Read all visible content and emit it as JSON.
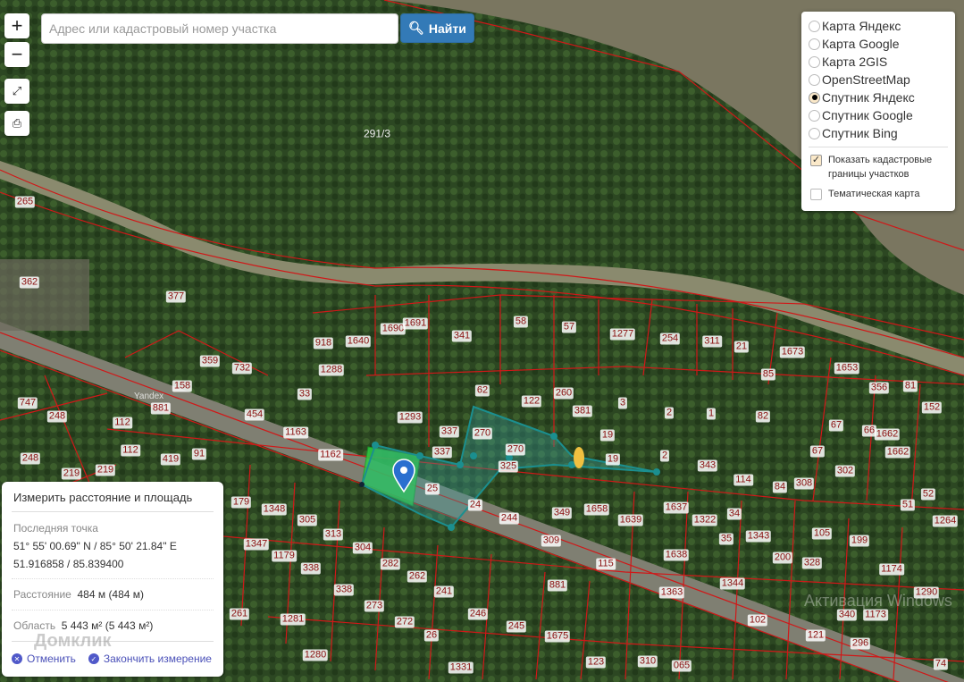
{
  "search": {
    "placeholder": "Адрес или кадастровый номер участка",
    "button": "Найти"
  },
  "controls": {
    "zoom_in": "+",
    "zoom_out": "−"
  },
  "layers": {
    "options": [
      {
        "label": "Карта Яндекс",
        "selected": false
      },
      {
        "label": "Карта Google",
        "selected": false
      },
      {
        "label": "Карта 2GIS",
        "selected": false
      },
      {
        "label": "OpenStreetMap",
        "selected": false
      },
      {
        "label": "Спутник Яндекс",
        "selected": true
      },
      {
        "label": "Спутник Google",
        "selected": false
      },
      {
        "label": "Спутник Bing",
        "selected": false
      }
    ],
    "show_cadastral": "Показать кадастровые границы участков",
    "show_cadastral_checked": true,
    "thematic": "Тематическая карта",
    "thematic_checked": false
  },
  "measure": {
    "title": "Измерить расстояние и площадь",
    "last_point_label": "Последняя точка",
    "dms": "51° 55' 00.69\" N / 85° 50' 21.84\" E",
    "decimal": "51.916858 / 85.839400",
    "distance_label": "Расстояние",
    "distance": "484 м (484 м)",
    "area_label": "Область",
    "area": "5 443 м² (5 443 м²)",
    "cancel": "Отменить",
    "finish": "Закончить измерение"
  },
  "map": {
    "parcels": [
      "291/3",
      "265",
      "362",
      "377",
      "359",
      "732",
      "918",
      "1640",
      "1690",
      "1691",
      "341",
      "58",
      "57",
      "1277",
      "254",
      "311",
      "21",
      "1673",
      "1653",
      "356",
      "81",
      "152",
      "1288",
      "158",
      "33",
      "62",
      "122",
      "260",
      "381",
      "3",
      "2",
      "1",
      "82",
      "85",
      "747",
      "248",
      "881",
      "112",
      "454",
      "1293",
      "337",
      "270",
      "270",
      "19",
      "19",
      "2",
      "67",
      "66",
      "1662",
      "1662",
      "1163",
      "1162",
      "337",
      "325",
      "343",
      "114",
      "67",
      "302",
      "308",
      "84",
      "52",
      "51",
      "112",
      "91",
      "419",
      "219",
      "219",
      "248",
      "25",
      "24",
      "244",
      "349",
      "1658",
      "1639",
      "1637",
      "1322",
      "34",
      "35",
      "1343",
      "200",
      "105",
      "199",
      "328",
      "1174",
      "1264",
      "179",
      "1348",
      "305",
      "313",
      "1347",
      "1179",
      "304",
      "338",
      "282",
      "262",
      "309",
      "1638",
      "115",
      "881",
      "1363",
      "1344",
      "338",
      "241",
      "273",
      "272",
      "246",
      "245",
      "261",
      "1281",
      "1675",
      "102",
      "121",
      "296",
      "340",
      "1290",
      "1280",
      "1331",
      "123",
      "310",
      "74",
      "26",
      "065",
      "1173"
    ],
    "watermark": "Домклик",
    "os_watermark": "Активация Windows",
    "provider": "Yandex"
  }
}
